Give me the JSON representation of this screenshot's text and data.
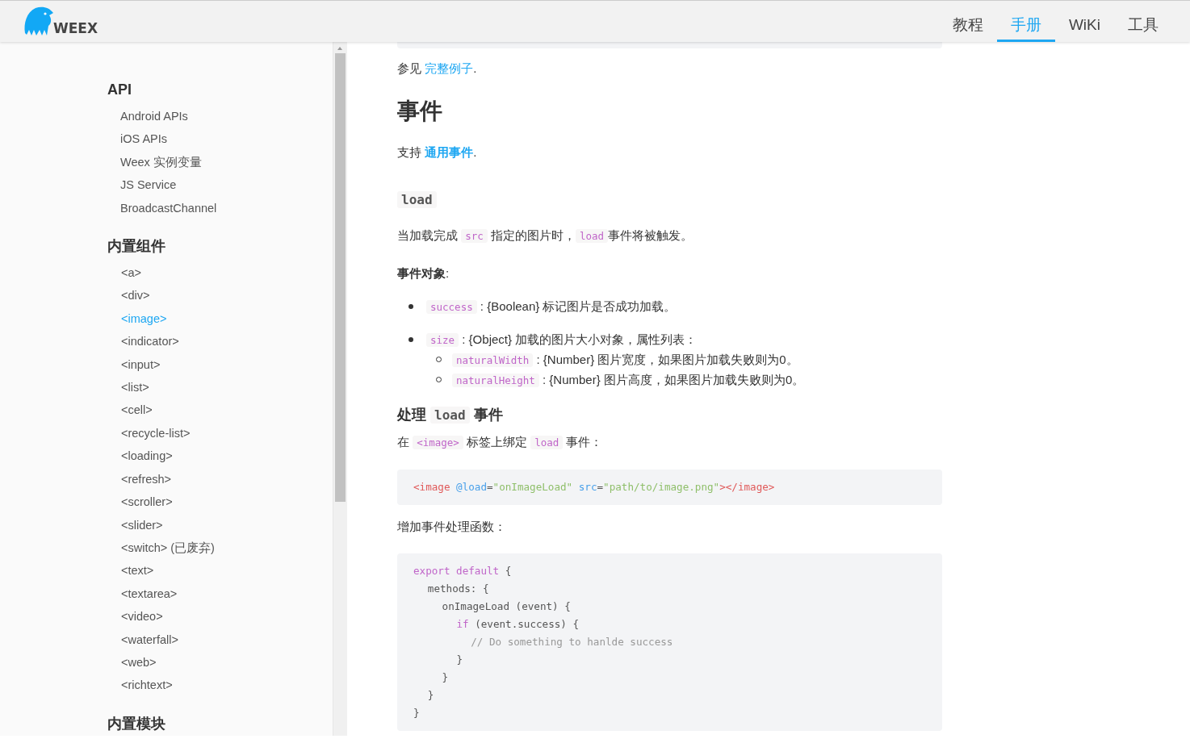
{
  "header": {
    "logo": "WEEX",
    "nav": [
      {
        "label": "教程",
        "selected": false
      },
      {
        "label": "手册",
        "selected": true
      },
      {
        "label": "WiKi",
        "selected": false
      },
      {
        "label": "工具",
        "selected": false
      }
    ]
  },
  "sidebar": {
    "sections": [
      {
        "title": "API",
        "items": [
          {
            "label": "Android APIs",
            "selected": false
          },
          {
            "label": "iOS APIs",
            "selected": false
          },
          {
            "label": "Weex 实例变量",
            "selected": false
          },
          {
            "label": "JS Service",
            "selected": false
          },
          {
            "label": "BroadcastChannel",
            "selected": false
          }
        ]
      },
      {
        "title": "内置组件",
        "items": [
          {
            "label": "<a>",
            "selected": false
          },
          {
            "label": "<div>",
            "selected": false
          },
          {
            "label": "<image>",
            "selected": true
          },
          {
            "label": "<indicator>",
            "selected": false
          },
          {
            "label": "<input>",
            "selected": false
          },
          {
            "label": "<list>",
            "selected": false
          },
          {
            "label": "<cell>",
            "selected": false
          },
          {
            "label": "<recycle-list>",
            "selected": false
          },
          {
            "label": "<loading>",
            "selected": false
          },
          {
            "label": "<refresh>",
            "selected": false
          },
          {
            "label": "<scroller>",
            "selected": false
          },
          {
            "label": "<slider>",
            "selected": false
          },
          {
            "label": "<switch> (已废弃)",
            "selected": false
          },
          {
            "label": "<text>",
            "selected": false
          },
          {
            "label": "<textarea>",
            "selected": false
          },
          {
            "label": "<video>",
            "selected": false
          },
          {
            "label": "<waterfall>",
            "selected": false
          },
          {
            "label": "<web>",
            "selected": false
          },
          {
            "label": "<richtext>",
            "selected": false
          }
        ]
      },
      {
        "title": "内置模块"
      }
    ]
  },
  "content": [
    {
      "kind": "code"
    },
    {
      "kind": "para",
      "parts": [
        {
          "kind": "text",
          "text": "参见 "
        },
        {
          "kind": "link",
          "text": "完整例子"
        },
        {
          "kind": "text",
          "text": "."
        }
      ]
    },
    {
      "kind": "h2",
      "parts": [
        {
          "kind": "text",
          "text": "事件"
        }
      ]
    },
    {
      "kind": "para",
      "parts": [
        {
          "kind": "text",
          "text": "支持 "
        },
        {
          "kind": "boldlink",
          "text": "通用事件"
        },
        {
          "kind": "text",
          "text": "."
        }
      ]
    },
    {
      "kind": "h4",
      "parts": [
        {
          "kind": "code",
          "text": "load"
        }
      ]
    },
    {
      "kind": "para",
      "parts": [
        {
          "kind": "text",
          "text": "当加载完成 "
        },
        {
          "kind": "code",
          "text": "src"
        },
        {
          "kind": "text",
          "text": " 指定的图片时，"
        },
        {
          "kind": "code",
          "text": "load"
        },
        {
          "kind": "text",
          "text": "事件将被触发。"
        }
      ]
    },
    {
      "kind": "strong",
      "parts": [
        {
          "kind": "text",
          "text": "事件对象"
        },
        {
          "kind": "plain",
          "text": ":"
        }
      ]
    },
    {
      "kind": "list",
      "items": [
        {
          "parts": [
            {
              "kind": "code",
              "text": "success"
            },
            {
              "kind": "text",
              "text": " : {Boolean} 标记图片是否成功加载。"
            }
          ]
        },
        {
          "parts": [
            {
              "kind": "code",
              "text": "size"
            },
            {
              "kind": "text",
              "text": " : {Object} 加载的图片大小对象，属性列表："
            }
          ],
          "children": [
            {
              "parts": [
                {
                  "kind": "code",
                  "text": "naturalWidth"
                },
                {
                  "kind": "text",
                  "text": " : {Number} 图片宽度，如果图片加载失败则为0。"
                }
              ]
            },
            {
              "parts": [
                {
                  "kind": "code",
                  "text": "naturalHeight"
                },
                {
                  "kind": "text",
                  "text": " : {Number} 图片高度，如果图片加载失败则为0。"
                }
              ]
            }
          ]
        }
      ]
    },
    {
      "kind": "h3",
      "parts": [
        {
          "kind": "text",
          "text": "处理 "
        },
        {
          "kind": "code",
          "text": "load"
        },
        {
          "kind": "text",
          "text": " 事件"
        }
      ]
    },
    {
      "kind": "para",
      "parts": [
        {
          "kind": "text",
          "text": "在 "
        },
        {
          "kind": "code",
          "text": "<image>"
        },
        {
          "kind": "text",
          "text": " 标签上绑定 "
        },
        {
          "kind": "code",
          "text": "load"
        },
        {
          "kind": "text",
          "text": " 事件："
        }
      ]
    },
    {
      "kind": "code",
      "lines": [
        {
          "tokens": [
            {
              "kind": "tag",
              "text": "<image "
            },
            {
              "kind": "attr",
              "text": "@load"
            },
            {
              "kind": "plain",
              "text": "="
            },
            {
              "kind": "string",
              "text": "\"onImageLoad\" "
            },
            {
              "kind": "attr",
              "text": "src"
            },
            {
              "kind": "plain",
              "text": "="
            },
            {
              "kind": "string",
              "text": "\"path/to/image.png\""
            },
            {
              "kind": "tag",
              "text": "></image>"
            }
          ]
        }
      ]
    },
    {
      "kind": "para",
      "parts": [
        {
          "kind": "text",
          "text": "增加事件处理函数："
        }
      ]
    },
    {
      "kind": "code",
      "lines": [
        {
          "tokens": [
            {
              "kind": "keyword",
              "text": "export default"
            },
            {
              "kind": "plain",
              "text": " {"
            }
          ],
          "children": [
            {
              "tokens": [
                {
                  "kind": "plain",
                  "text": "methods: {"
                }
              ],
              "children": [
                {
                  "tokens": [
                    {
                      "kind": "plain",
                      "text": "onImageLoad (event) {"
                    }
                  ],
                  "children": [
                    {
                      "tokens": [
                        {
                          "kind": "keyword",
                          "text": "if"
                        },
                        {
                          "kind": "plain",
                          "text": " (event.success) {"
                        }
                      ],
                      "children": [
                        {
                          "tokens": [
                            {
                              "kind": "comment",
                              "text": "// Do something to hanlde success"
                            }
                          ]
                        }
                      ]
                    },
                    {
                      "tokens": [
                        {
                          "kind": "plain",
                          "text": "}"
                        }
                      ]
                    }
                  ]
                },
                {
                  "tokens": [
                    {
                      "kind": "plain",
                      "text": "}"
                    }
                  ]
                }
              ]
            },
            {
              "tokens": [
                {
                  "kind": "plain",
                  "text": "}"
                }
              ]
            }
          ]
        },
        {
          "tokens": [
            {
              "kind": "plain",
              "text": "}"
            }
          ]
        }
      ]
    }
  ]
}
